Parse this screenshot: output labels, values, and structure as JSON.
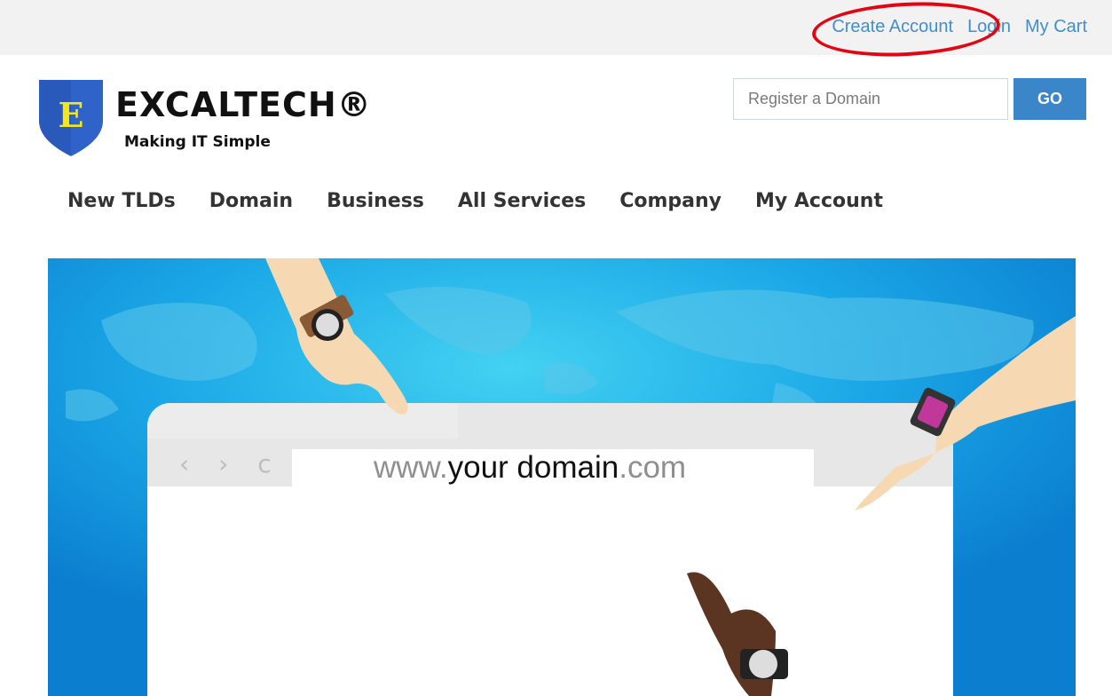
{
  "top_links": {
    "create_account": "Create Account",
    "login": "Login",
    "my_cart": "My Cart"
  },
  "brand": {
    "name": "EXCALTECH®",
    "tagline": "Making IT Simple",
    "logo_letter": "E"
  },
  "domain_search": {
    "placeholder": "Register a Domain",
    "button_label": "GO"
  },
  "nav": {
    "items": [
      "New TLDs",
      "Domain",
      "Business",
      "All Services",
      "Company",
      "My Account"
    ]
  },
  "hero": {
    "browser_controls": "‹ › c",
    "address_prefix": "www.",
    "address_main": "your domain",
    "address_suffix": ".com"
  },
  "colors": {
    "link": "#3f8fd0",
    "button": "#3b86c8",
    "highlight": "#e10612",
    "hero_bg": "#0f88d8"
  }
}
